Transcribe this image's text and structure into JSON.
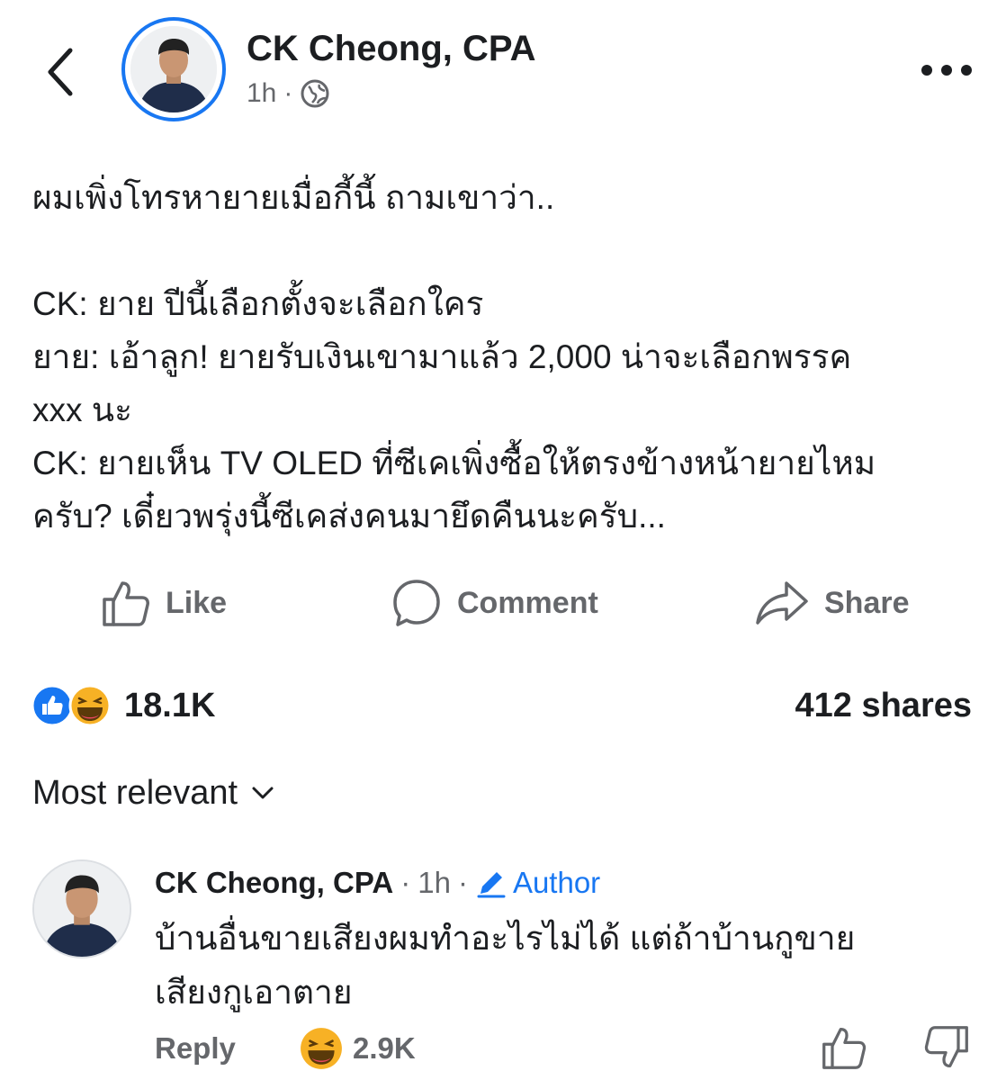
{
  "header": {
    "author": "CK Cheong, CPA",
    "time": "1h",
    "dot": "·",
    "back_icon": "chevron-left-icon",
    "privacy_icon": "globe-icon",
    "more_icon": "more-dots-icon"
  },
  "post": {
    "text": "ผมเพิ่งโทรหายายเมื่อกี้นี้ ถามเขาว่า..\n\nCK: ยาย ปีนี้เลือกตั้งจะเลือกใคร\nยาย: เอ้าลูก! ยายรับเงินเขามาแล้ว 2,000 น่าจะเลือกพรรค\nxxx นะ\nCK: ยายเห็น TV OLED ที่ซีเคเพิ่งซื้อให้ตรงข้างหน้ายายไหม\nครับ? เดี๋ยวพรุ่งนี้ซีเคส่งคนมายึดคืนนะครับ..."
  },
  "actions": {
    "like": "Like",
    "comment": "Comment",
    "share": "Share"
  },
  "stats": {
    "reactions_count": "18.1K",
    "shares": "412 shares",
    "reaction_icons": [
      "like-reaction-icon",
      "haha-reaction-icon"
    ]
  },
  "sort": {
    "label": "Most relevant",
    "icon": "chevron-down-icon"
  },
  "comment": {
    "author": "CK Cheong, CPA",
    "dot": "·",
    "time": "1h",
    "author_badge": "Author",
    "text": "บ้านอื่นขายเสียงผมทำอะไรไม่ได้ แต่ถ้าบ้านกูขาย\nเสียงกูเอาตาย",
    "reply_label": "Reply",
    "reaction_count": "2.9K"
  },
  "colors": {
    "accent": "#1877f2",
    "muted": "#65676b",
    "text": "#1c1e21",
    "haha": "#f7b125"
  }
}
